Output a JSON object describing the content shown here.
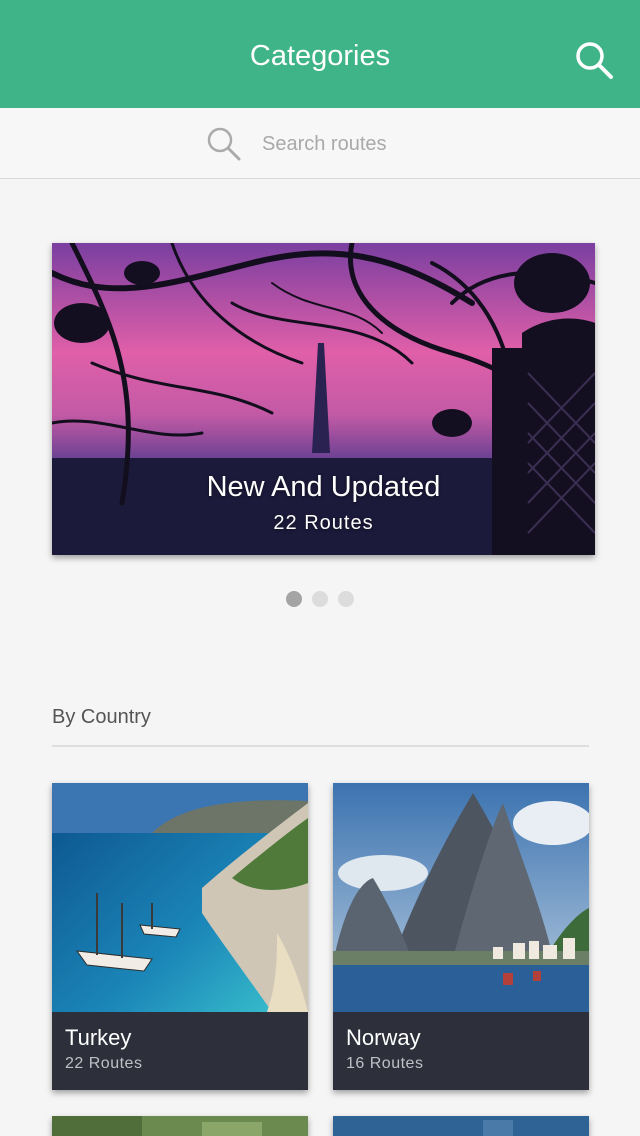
{
  "header": {
    "title": "Categories"
  },
  "search": {
    "placeholder": "Search routes"
  },
  "featured": {
    "title": "New And Updated",
    "subtitle": "22 Routes"
  },
  "carousel": {
    "pages": 3,
    "active": 0
  },
  "by_country": {
    "title": "By Country",
    "items": [
      {
        "name": "Turkey",
        "routes": "22 Routes"
      },
      {
        "name": "Norway",
        "routes": "16 Routes"
      }
    ]
  },
  "colors": {
    "accent": "#3fb488",
    "card_footer": "#2d2f3a"
  }
}
